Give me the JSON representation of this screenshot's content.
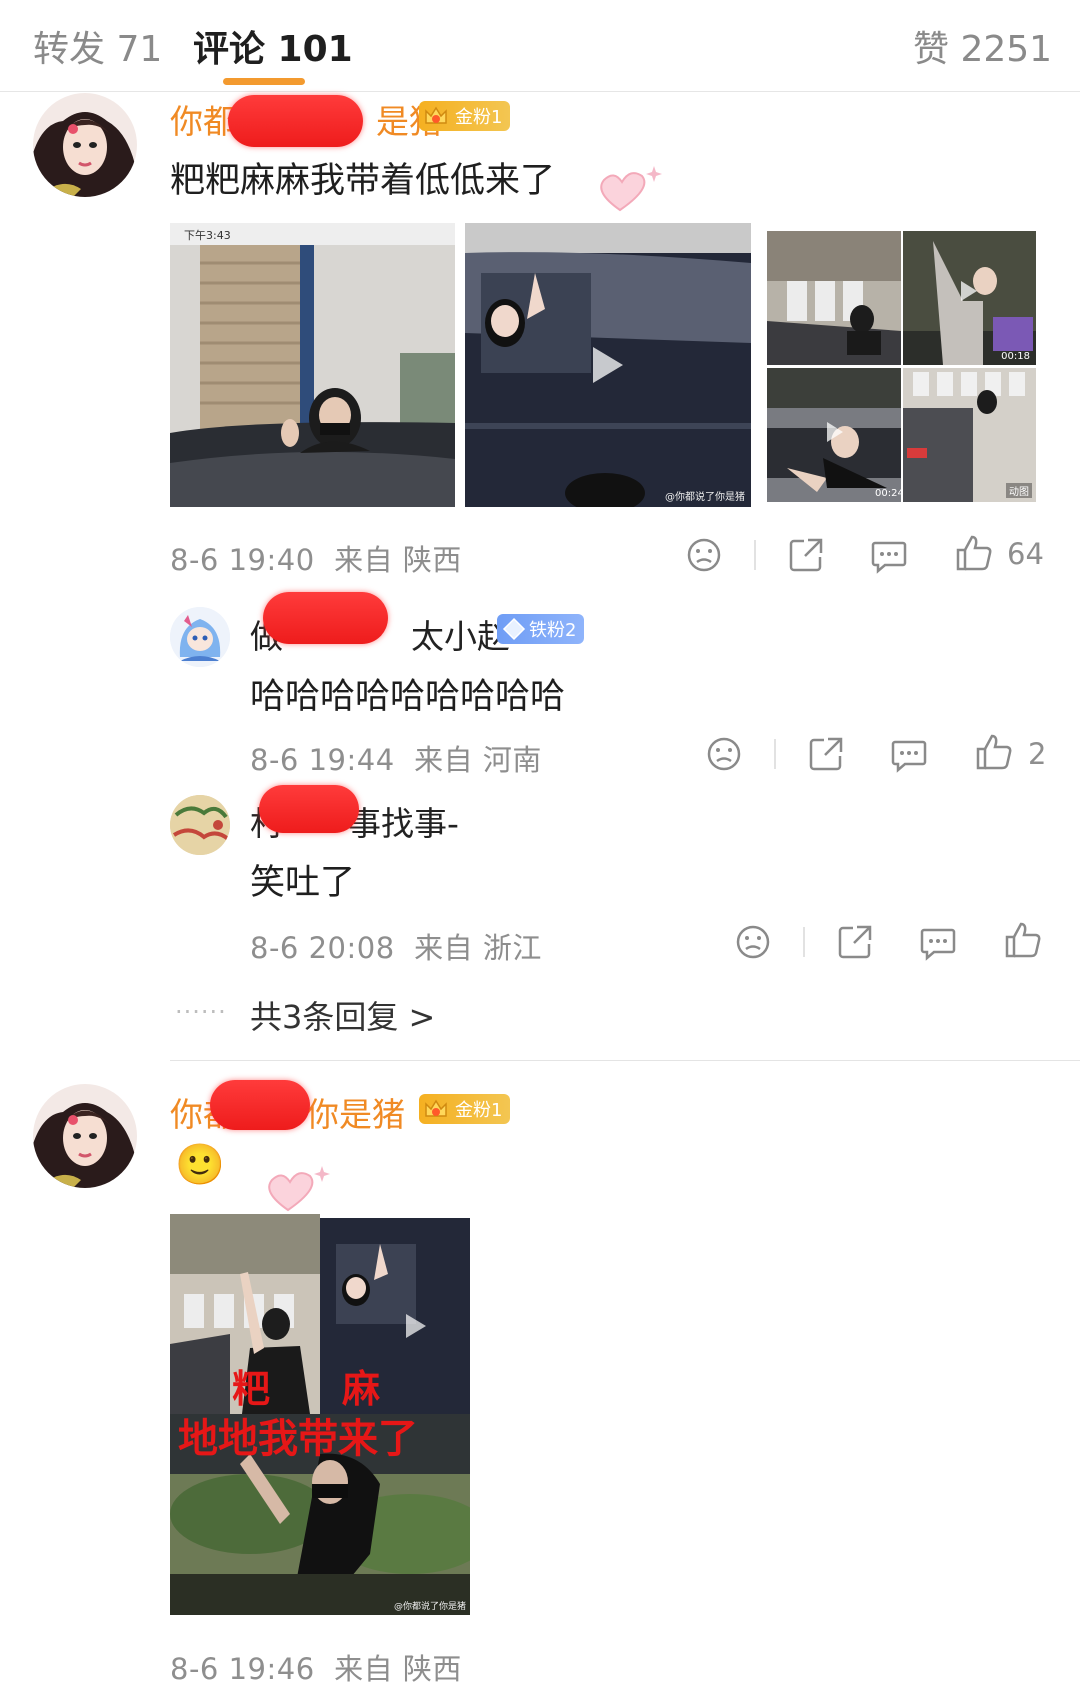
{
  "tabs": {
    "repost_label": "转发 71",
    "comment_label": "评论 101",
    "like_label": "赞 2251"
  },
  "comments": [
    {
      "name_prefix": "你都",
      "name_suffix": "是猪",
      "badge": "金粉1",
      "text": "粑粑麻麻我带着低低来了",
      "time": "8-6 19:40",
      "from": "来自 陕西",
      "likes": "64"
    },
    {
      "name_prefix": "你都",
      "name_suffix": "你是猪",
      "badge": "金粉1",
      "emoji": "🙂",
      "time": "8-6 19:46",
      "from": "来自 陕西",
      "meme_line1_left": "粑",
      "meme_line1_right": "麻",
      "meme_line2": "地地我带来了"
    }
  ],
  "replies": [
    {
      "name_prefix": "做",
      "name_suffix": "太小赵",
      "badge": "铁粉2",
      "text": "哈哈哈哈哈哈哈哈哈",
      "time": "8-6 19:44",
      "from": "来自 河南",
      "likes": "2"
    },
    {
      "name_prefix": "村",
      "name_suffix": "事找事-",
      "text": "笑吐了",
      "time": "8-6 20:08",
      "from": "来自 浙江"
    }
  ],
  "more_replies": "共3条回复 >",
  "video_overlays": {
    "status_time": "下午3:43",
    "dur1": "00:18",
    "dur2": "00:24",
    "gif": "动图",
    "watermark": "@你都说了你是猪"
  },
  "colors": {
    "accent_orange": "#f39a2f",
    "username_orange": "#f08a24",
    "badge_gold": "#f5b021",
    "badge_iron": "#6f9df5",
    "meta_gray": "#8e8e8e",
    "meme_red": "#e61717"
  },
  "icons": [
    "face-icon",
    "share-icon",
    "comment-icon",
    "like-icon",
    "play-icon",
    "crown-icon",
    "diamond-icon"
  ]
}
